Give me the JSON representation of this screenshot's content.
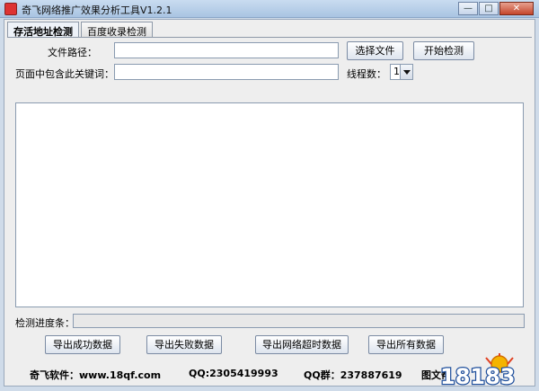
{
  "window": {
    "title": "奇飞网络推广效果分析工具V1.2.1"
  },
  "tabs": [
    {
      "label": "存活地址检测",
      "active": true
    },
    {
      "label": "百度收录检测",
      "active": false
    }
  ],
  "form": {
    "file_path_label": "文件路径：",
    "file_path_value": "",
    "select_file_label": "选择文件",
    "start_check_label": "开始检测",
    "keyword_label": "页面中包含此关键词：",
    "keyword_value": "",
    "threads_label": "线程数：",
    "threads_value": "1"
  },
  "progress": {
    "label": "检测进度条：",
    "value": 0
  },
  "export_buttons": {
    "success": "导出成功数据",
    "fail": "导出失败数据",
    "timeout": "导出网络超时数据",
    "all": "导出所有数据"
  },
  "footer": {
    "software": "奇飞软件：www.18qf.com",
    "qq": "QQ:2305419993",
    "qq_group": "QQ群：237887619",
    "help": "图文帮",
    "watermark": "18183"
  }
}
